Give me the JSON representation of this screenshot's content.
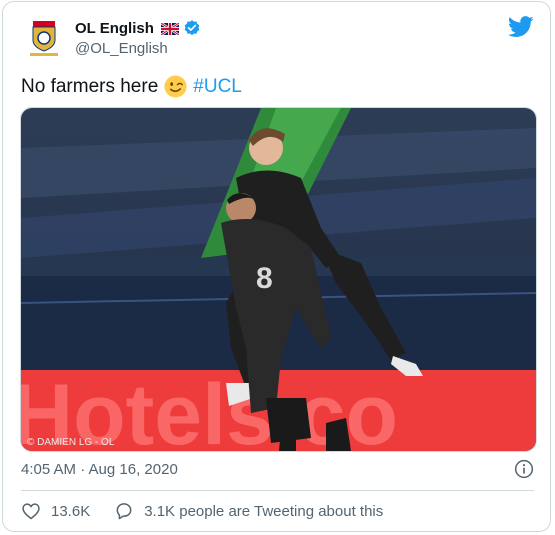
{
  "author": {
    "display_name": "OL English",
    "handle": "@OL_English",
    "avatar_label": "OL English",
    "flag": "united-kingdom-flag-icon",
    "verified": true
  },
  "tweet": {
    "text": "No farmers here",
    "emoji": "winking-face-emoji",
    "hashtag": "#UCL"
  },
  "media": {
    "credit": "© DAMIEN LG - OL",
    "banner_text": "Hotels.co"
  },
  "meta": {
    "timestamp": "4:05 AM · Aug 16, 2020"
  },
  "actions": {
    "likes": "13.6K",
    "conversation": "3.1K people are Tweeting about this"
  },
  "colors": {
    "accent": "#1d9bf0",
    "text": "#0f1419",
    "secondary": "#536471",
    "border": "#cfd9de"
  }
}
